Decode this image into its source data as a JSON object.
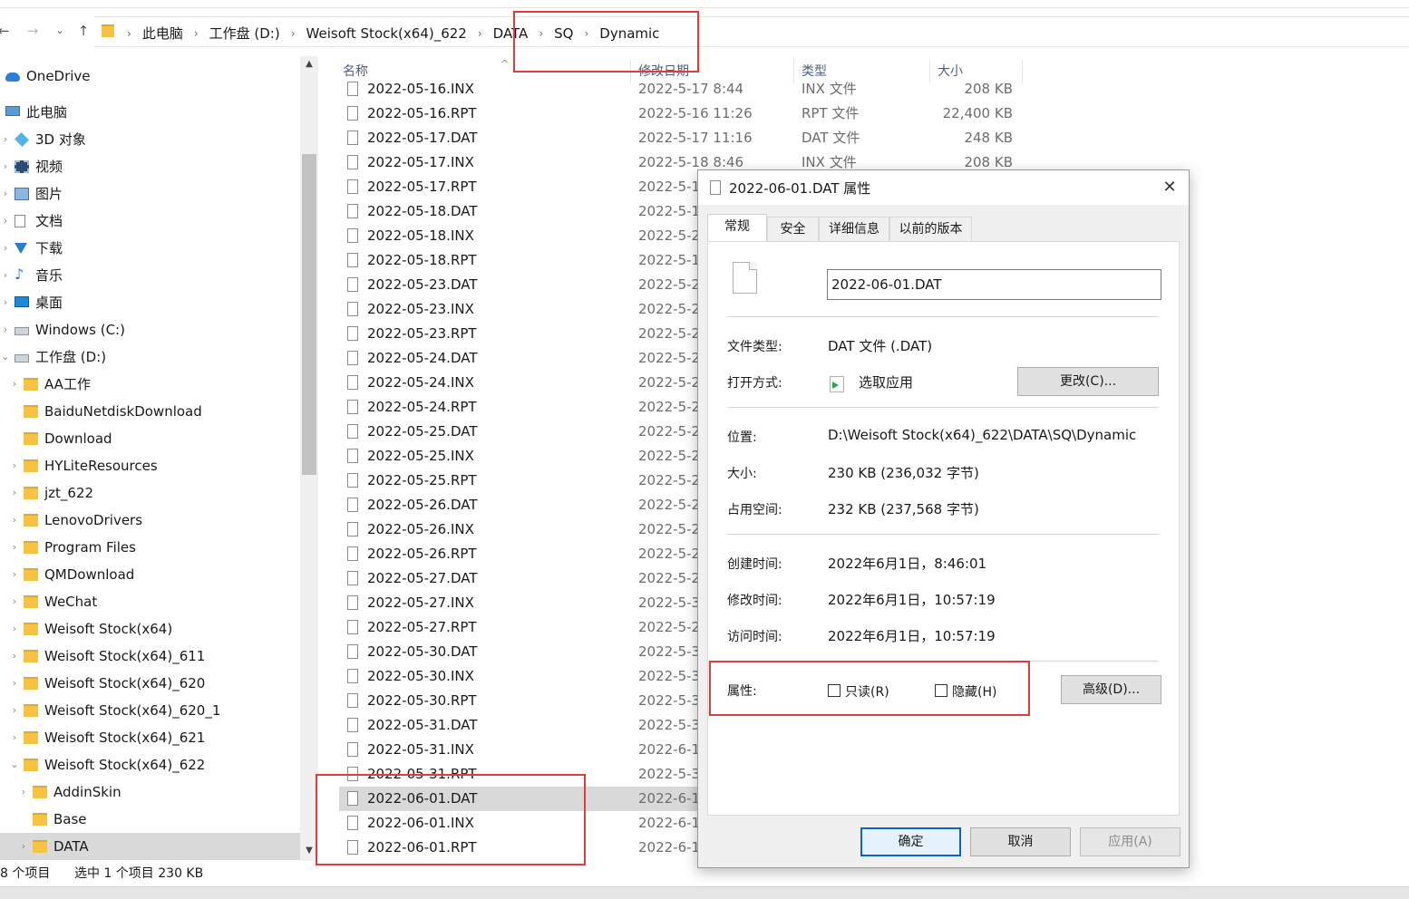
{
  "breadcrumbs": [
    "此电脑",
    "工作盘 (D:)",
    "Weisoft Stock(x64)_622",
    "DATA",
    "SQ",
    "Dynamic"
  ],
  "nav_tree": [
    {
      "label": "OneDrive",
      "icon": "onedrive-icon",
      "type": "cloud",
      "expander": ""
    },
    {
      "label": "此电脑",
      "icon": "this-pc-icon",
      "type": "pc",
      "expander": "⌄"
    },
    {
      "label": "3D 对象",
      "icon": "3d-objects-icon",
      "type": "3d",
      "expander": "›"
    },
    {
      "label": "视频",
      "icon": "videos-icon",
      "type": "video",
      "expander": "›"
    },
    {
      "label": "图片",
      "icon": "pictures-icon",
      "type": "pic",
      "expander": "›"
    },
    {
      "label": "文档",
      "icon": "documents-icon",
      "type": "doc",
      "expander": "›"
    },
    {
      "label": "下载",
      "icon": "downloads-icon",
      "type": "down",
      "expander": "›"
    },
    {
      "label": "音乐",
      "icon": "music-icon",
      "type": "music",
      "expander": "›"
    },
    {
      "label": "桌面",
      "icon": "desktop-icon",
      "type": "desk",
      "expander": "›"
    },
    {
      "label": "Windows (C:)",
      "icon": "drive-icon",
      "type": "drive",
      "expander": "›"
    },
    {
      "label": "工作盘 (D:)",
      "icon": "drive-icon",
      "type": "drive",
      "expander": "⌄"
    },
    {
      "label": "AA工作",
      "icon": "folder-icon",
      "type": "folder",
      "expander": "›"
    },
    {
      "label": "BaiduNetdiskDownload",
      "icon": "folder-icon",
      "type": "folder",
      "expander": ""
    },
    {
      "label": "Download",
      "icon": "folder-icon",
      "type": "folder",
      "expander": ""
    },
    {
      "label": "HYLiteResources",
      "icon": "folder-icon",
      "type": "folder",
      "expander": "›"
    },
    {
      "label": "jzt_622",
      "icon": "folder-icon",
      "type": "folder",
      "expander": "›"
    },
    {
      "label": "LenovoDrivers",
      "icon": "folder-icon",
      "type": "folder",
      "expander": "›"
    },
    {
      "label": "Program Files",
      "icon": "folder-icon",
      "type": "folder",
      "expander": "›"
    },
    {
      "label": "QMDownload",
      "icon": "folder-icon",
      "type": "folder",
      "expander": "›"
    },
    {
      "label": "WeChat",
      "icon": "folder-icon",
      "type": "folder",
      "expander": "›"
    },
    {
      "label": "Weisoft Stock(x64)",
      "icon": "folder-icon",
      "type": "folder",
      "expander": "›"
    },
    {
      "label": "Weisoft Stock(x64)_611",
      "icon": "folder-icon",
      "type": "folder",
      "expander": "›"
    },
    {
      "label": "Weisoft Stock(x64)_620",
      "icon": "folder-icon",
      "type": "folder",
      "expander": "›"
    },
    {
      "label": "Weisoft Stock(x64)_620_1",
      "icon": "folder-icon",
      "type": "folder",
      "expander": "›"
    },
    {
      "label": "Weisoft Stock(x64)_621",
      "icon": "folder-icon",
      "type": "folder",
      "expander": "›"
    },
    {
      "label": "Weisoft Stock(x64)_622",
      "icon": "folder-icon",
      "type": "folder",
      "expander": "⌄"
    },
    {
      "label": "AddinSkin",
      "icon": "folder-icon",
      "type": "folder",
      "expander": "›"
    },
    {
      "label": "Base",
      "icon": "folder-icon",
      "type": "folder",
      "expander": ""
    },
    {
      "label": "DATA",
      "icon": "folder-icon",
      "type": "folder",
      "expander": "›",
      "selected": true
    }
  ],
  "columns": {
    "name": "名称",
    "modified": "修改日期",
    "type": "类型",
    "size": "大小"
  },
  "files": [
    {
      "name": "2022-05-16.INX",
      "date": "2022-5-17 8:44",
      "type": "INX 文件",
      "size": "208 KB"
    },
    {
      "name": "2022-05-16.RPT",
      "date": "2022-5-16 11:26",
      "type": "RPT 文件",
      "size": "22,400 KB"
    },
    {
      "name": "2022-05-17.DAT",
      "date": "2022-5-17 11:16",
      "type": "DAT 文件",
      "size": "248 KB"
    },
    {
      "name": "2022-05-17.INX",
      "date": "2022-5-18 8:46",
      "type": "INX 文件",
      "size": "208 KB"
    },
    {
      "name": "2022-05-17.RPT",
      "date": "2022-5-1"
    },
    {
      "name": "2022-05-18.DAT",
      "date": "2022-5-1"
    },
    {
      "name": "2022-05-18.INX",
      "date": "2022-5-2"
    },
    {
      "name": "2022-05-18.RPT",
      "date": "2022-5-1"
    },
    {
      "name": "2022-05-23.DAT",
      "date": "2022-5-2"
    },
    {
      "name": "2022-05-23.INX",
      "date": "2022-5-2"
    },
    {
      "name": "2022-05-23.RPT",
      "date": "2022-5-2"
    },
    {
      "name": "2022-05-24.DAT",
      "date": "2022-5-2"
    },
    {
      "name": "2022-05-24.INX",
      "date": "2022-5-2"
    },
    {
      "name": "2022-05-24.RPT",
      "date": "2022-5-2"
    },
    {
      "name": "2022-05-25.DAT",
      "date": "2022-5-2"
    },
    {
      "name": "2022-05-25.INX",
      "date": "2022-5-2"
    },
    {
      "name": "2022-05-25.RPT",
      "date": "2022-5-2"
    },
    {
      "name": "2022-05-26.DAT",
      "date": "2022-5-2"
    },
    {
      "name": "2022-05-26.INX",
      "date": "2022-5-2"
    },
    {
      "name": "2022-05-26.RPT",
      "date": "2022-5-2"
    },
    {
      "name": "2022-05-27.DAT",
      "date": "2022-5-2"
    },
    {
      "name": "2022-05-27.INX",
      "date": "2022-5-3"
    },
    {
      "name": "2022-05-27.RPT",
      "date": "2022-5-2"
    },
    {
      "name": "2022-05-30.DAT",
      "date": "2022-5-3"
    },
    {
      "name": "2022-05-30.INX",
      "date": "2022-5-3"
    },
    {
      "name": "2022-05-30.RPT",
      "date": "2022-5-3"
    },
    {
      "name": "2022-05-31.DAT",
      "date": "2022-5-3"
    },
    {
      "name": "2022-05-31.INX",
      "date": "2022-6-1"
    },
    {
      "name": "2022-05-31.RPT",
      "date": "2022-5-3"
    },
    {
      "name": "2022-06-01.DAT",
      "date": "2022-6-1",
      "selected": true
    },
    {
      "name": "2022-06-01.INX",
      "date": "2022-6-1"
    },
    {
      "name": "2022-06-01.RPT",
      "date": "2022-6-1"
    }
  ],
  "status": {
    "count": "8 个项目",
    "selection": "选中 1 个项目  230 KB"
  },
  "dialog": {
    "title": "2022-06-01.DAT 属性",
    "close": "✕",
    "tabs": [
      "常规",
      "安全",
      "详细信息",
      "以前的版本"
    ],
    "filename": "2022-06-01.DAT",
    "labels": {
      "type": "文件类型:",
      "opens_with": "打开方式:",
      "location": "位置:",
      "size": "大小:",
      "size_on_disk": "占用空间:",
      "created": "创建时间:",
      "modified": "修改时间:",
      "accessed": "访问时间:",
      "attributes": "属性:"
    },
    "values": {
      "type": "DAT 文件 (.DAT)",
      "opens_with": "选取应用",
      "location": "D:\\Weisoft Stock(x64)_622\\DATA\\SQ\\Dynamic",
      "size": "230 KB (236,032 字节)",
      "size_on_disk": "232 KB (237,568 字节)",
      "created": "2022年6月1日，8:46:01",
      "modified": "2022年6月1日，10:57:19",
      "accessed": "2022年6月1日，10:57:19"
    },
    "change_button": "更改(C)...",
    "readonly": "只读(R)",
    "hidden": "隐藏(H)",
    "advanced_button": "高级(D)...",
    "ok": "确定",
    "cancel": "取消",
    "apply": "应用(A)"
  },
  "accent_colors": {
    "highlight": "#e23b3b",
    "focus": "#0a64c7",
    "selection": "#d9d9d9"
  }
}
